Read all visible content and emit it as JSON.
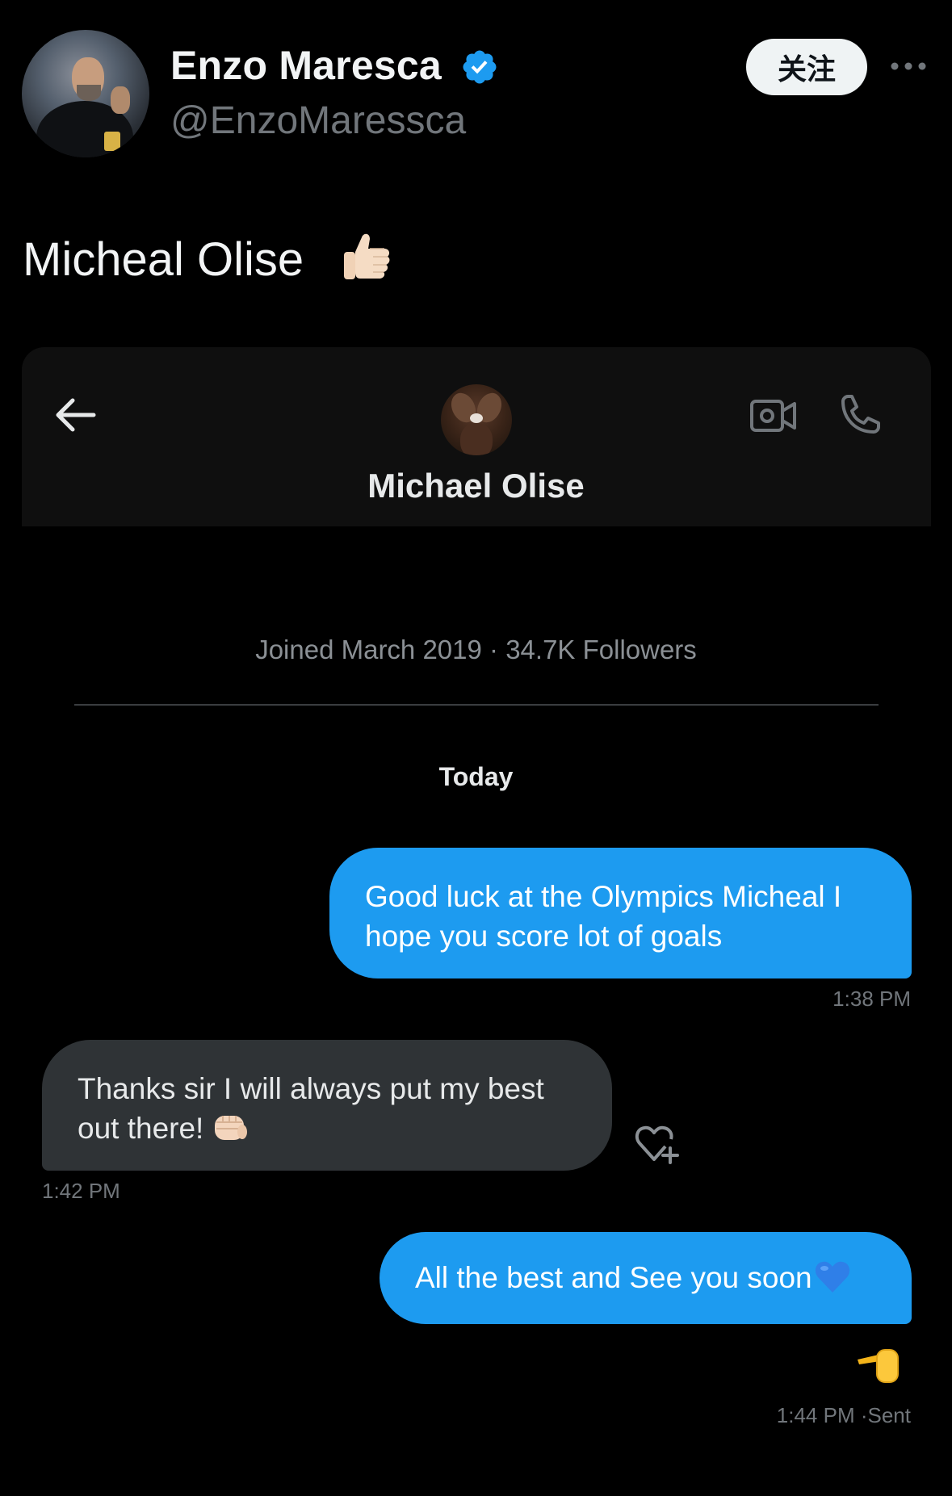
{
  "tweet": {
    "author": {
      "display_name": "Enzo Maresca",
      "handle": "@EnzoMaressca",
      "verified": true
    },
    "follow_label": "关注",
    "more_icon": "ellipsis-icon",
    "text": "Micheal Olise",
    "text_emoji": "thumbs-up-icon"
  },
  "dm": {
    "contact_name": "Michael Olise",
    "joined_info": "Joined March 2019 · 34.7K Followers",
    "day_label": "Today",
    "messages": [
      {
        "direction": "outgoing",
        "text": "Good luck at the Olympics Micheal I hope you score lot of goals",
        "time": "1:38 PM"
      },
      {
        "direction": "incoming",
        "text": "Thanks sir I will always put my best out there!",
        "emoji": "fist-bump-icon",
        "time": "1:42 PM"
      },
      {
        "direction": "outgoing",
        "text": "All the best and See you soon",
        "emoji": "blue-heart-icon",
        "reaction": "pointing-hand-icon",
        "time": "1:44 PM",
        "status": "Sent"
      }
    ],
    "header_icons": [
      "back-arrow-icon",
      "video-call-icon",
      "phone-icon"
    ]
  },
  "colors": {
    "background": "#000000",
    "accent_blue": "#1d9bf0",
    "incoming_bubble": "#2f3336",
    "secondary_text": "#71767b",
    "verified_blue": "#1d9bf0"
  }
}
